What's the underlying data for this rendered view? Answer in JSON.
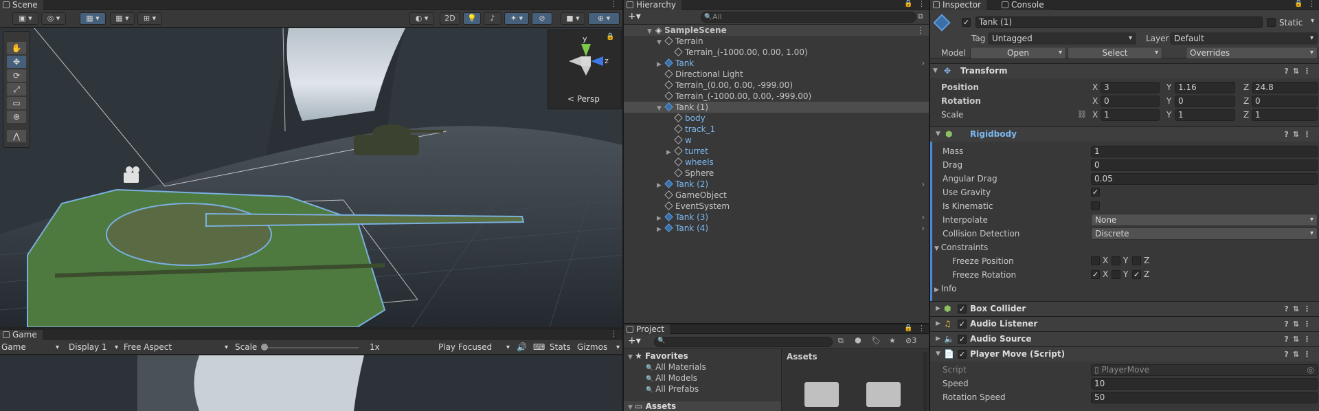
{
  "scene": {
    "tab": "Scene",
    "toolbar": {
      "mode_2d": "2D"
    },
    "persp_label": "< Persp",
    "gizmo_y": "y",
    "gizmo_z": "z"
  },
  "game": {
    "tab": "Game",
    "display_mode": "Game",
    "display": "Display 1",
    "aspect": "Free Aspect",
    "scale_label": "Scale",
    "scale_value": "1x",
    "play_mode": "Play Focused",
    "stats": "Stats",
    "gizmos": "Gizmos"
  },
  "hierarchy": {
    "tab": "Hierarchy",
    "search_placeholder": "All",
    "scene_name": "SampleScene",
    "items": [
      {
        "label": "Terrain"
      },
      {
        "label": "Terrain_(-1000.00, 0.00, 1.00)"
      },
      {
        "label": "Tank"
      },
      {
        "label": "Directional Light"
      },
      {
        "label": "Terrain_(0.00, 0.00, -999.00)"
      },
      {
        "label": "Terrain_(-1000.00, 0.00, -999.00)"
      },
      {
        "label": "Tank (1)"
      },
      {
        "label": "body"
      },
      {
        "label": "track_1"
      },
      {
        "label": "w"
      },
      {
        "label": "turret"
      },
      {
        "label": "wheels"
      },
      {
        "label": "Sphere"
      },
      {
        "label": "Tank (2)"
      },
      {
        "label": "GameObject"
      },
      {
        "label": "EventSystem"
      },
      {
        "label": "Tank (3)"
      },
      {
        "label": "Tank (4)"
      }
    ]
  },
  "project": {
    "tab": "Project",
    "hidden_count": "3",
    "favorites": "Favorites",
    "fav_items": [
      "All Materials",
      "All Models",
      "All Prefabs"
    ],
    "assets_header": "Assets",
    "assets_tree": "Assets"
  },
  "inspector": {
    "tab": "Inspector",
    "console_tab": "Console",
    "object_name": "Tank (1)",
    "static_label": "Static",
    "tag_label": "Tag",
    "tag_value": "Untagged",
    "layer_label": "Layer",
    "layer_value": "Default",
    "model_label": "Model",
    "open": "Open",
    "select": "Select",
    "overrides": "Overrides",
    "transform": {
      "title": "Transform",
      "position_label": "Position",
      "rotation_label": "Rotation",
      "scale_label": "Scale",
      "x": "X",
      "y": "Y",
      "z": "Z",
      "position": [
        "3",
        "1.16",
        "24.8"
      ],
      "rotation": [
        "0",
        "0",
        "0"
      ],
      "scale": [
        "1",
        "1",
        "1"
      ]
    },
    "rigidbody": {
      "title": "Rigidbody",
      "mass_label": "Mass",
      "mass": "1",
      "drag_label": "Drag",
      "drag": "0",
      "angular_label": "Angular Drag",
      "angular": "0.05",
      "gravity_label": "Use Gravity",
      "kinematic_label": "Is Kinematic",
      "interp_label": "Interpolate",
      "interp": "None",
      "collision_label": "Collision Detection",
      "collision": "Discrete",
      "constraints_label": "Constraints",
      "freeze_pos_label": "Freeze Position",
      "freeze_rot_label": "Freeze Rotation",
      "info_label": "Info"
    },
    "components": {
      "box_collider": "Box Collider",
      "audio_listener": "Audio Listener",
      "audio_source": "Audio Source",
      "player_move": "Player Move (Script)"
    },
    "script": {
      "script_label": "Script",
      "script_value": "PlayerMove",
      "speed_label": "Speed",
      "speed": "10",
      "rot_speed_label": "Rotation Speed",
      "rot_speed": "50"
    }
  }
}
